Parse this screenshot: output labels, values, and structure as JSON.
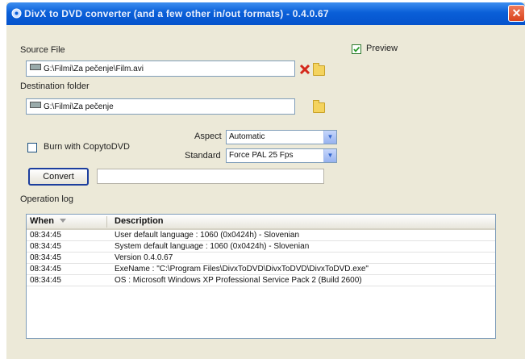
{
  "window": {
    "title": "DivX to DVD converter (and a few other in/out formats) - 0.4.0.67",
    "close_glyph": "✕"
  },
  "preview": {
    "label": "Preview",
    "checked": true
  },
  "source": {
    "label": "Source File",
    "value": "G:\\Filmi\\Za pečenje\\Film.avi"
  },
  "destination": {
    "label": "Destination folder",
    "value": "G:\\Filmi\\Za pečenje"
  },
  "burn": {
    "label": "Burn with CopytoDVD",
    "checked": false
  },
  "aspect": {
    "label": "Aspect",
    "value": "Automatic"
  },
  "standard": {
    "label": "Standard",
    "value": "Force PAL 25 Fps"
  },
  "convert_label": "Convert",
  "log": {
    "label": "Operation log",
    "columns": [
      "When",
      "Description"
    ],
    "rows": [
      {
        "when": "08:34:45",
        "description": "User default language : 1060 (0x0424h) - Slovenian"
      },
      {
        "when": "08:34:45",
        "description": "System default language : 1060 (0x0424h) - Slovenian"
      },
      {
        "when": "08:34:45",
        "description": "Version 0.4.0.67"
      },
      {
        "when": "08:34:45",
        "description": "ExeName : \"C:\\Program Files\\DivxToDVD\\DivxToDVD\\DivxToDVD.exe\""
      },
      {
        "when": "08:34:45",
        "description": "OS : Microsoft Windows XP Professional Service Pack 2 (Build 2600)"
      }
    ]
  },
  "colors": {
    "title_bar": "#0a5fd8",
    "window_bg": "#ece9d8",
    "close": "#d9431c"
  },
  "icons": {
    "app": "app-icon",
    "clear": "red-x-icon",
    "folder": "folder-icon",
    "dropdown": "chevron-down-icon",
    "sort": "sort-down-icon"
  }
}
